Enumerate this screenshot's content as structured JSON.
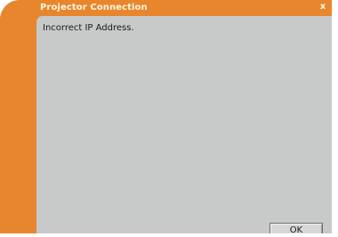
{
  "window": {
    "title": "Projector Connection",
    "close_glyph": "x"
  },
  "message": {
    "text": "Incorrect IP Address."
  },
  "buttons": {
    "ok_label": "OK"
  },
  "colors": {
    "accent": "#e8862e",
    "panel": "#c8c9c9"
  }
}
